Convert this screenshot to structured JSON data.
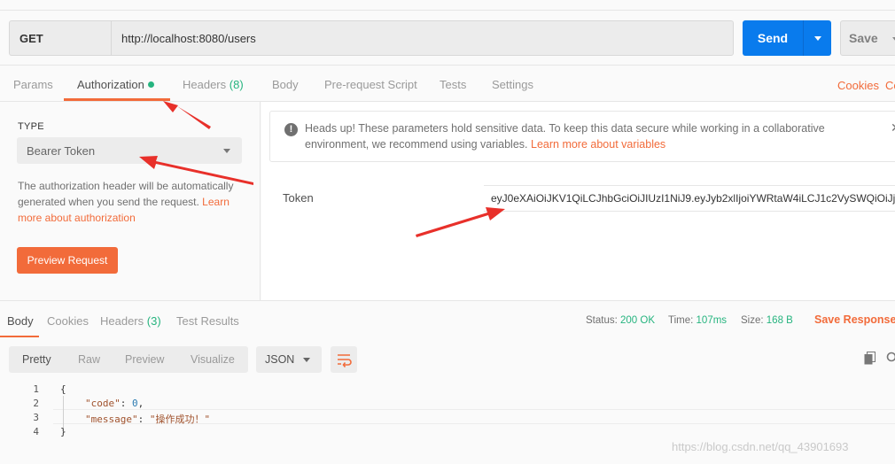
{
  "request": {
    "method": "GET",
    "url": "http://localhost:8080/users",
    "send_label": "Send",
    "save_label": "Save"
  },
  "request_tabs": [
    {
      "label": "Params"
    },
    {
      "label": "Authorization"
    },
    {
      "label": "Headers",
      "count": "(8)"
    },
    {
      "label": "Body"
    },
    {
      "label": "Pre-request Script"
    },
    {
      "label": "Tests"
    },
    {
      "label": "Settings"
    }
  ],
  "cookies_label": "Cookies",
  "code_label": "Co",
  "auth": {
    "type_label": "TYPE",
    "type_value": "Bearer Token",
    "description": "The authorization header will be automatically generated when you send the request.",
    "learn_more": "Learn more about authorization",
    "preview_label": "Preview Request",
    "notice_text": "Heads up! These parameters hold sensitive data. To keep this data secure while working in a collaborative environment, we recommend using variables.",
    "notice_link": "Learn more about variables",
    "token_label": "Token",
    "token_value": "eyJ0eXAiOiJKV1QiLCJhbGciOiJIUzI1NiJ9.eyJyb2xlIjoiYWRtaW4iLCJ1c2VySWQiOiJj..."
  },
  "response_tabs": [
    {
      "label": "Body"
    },
    {
      "label": "Cookies"
    },
    {
      "label": "Headers",
      "count": "(3)"
    },
    {
      "label": "Test Results"
    }
  ],
  "response_meta": {
    "status_label": "Status:",
    "status_value": "200 OK",
    "time_label": "Time:",
    "time_value": "107ms",
    "size_label": "Size:",
    "size_value": "168 B",
    "save_response": "Save Response"
  },
  "view_modes": [
    "Pretty",
    "Raw",
    "Preview",
    "Visualize"
  ],
  "format": "JSON",
  "code_lines": [
    "1",
    "2",
    "3",
    "4"
  ],
  "json": {
    "open": "{",
    "code_key": "\"code\"",
    "code_sep": ": ",
    "code_val": "0",
    "code_tail": ",",
    "msg_key": "\"message\"",
    "msg_sep": ": ",
    "msg_val": "\"操作成功！\"",
    "close": "}"
  },
  "watermark": "https://blog.csdn.net/qq_43901693",
  "colors": {
    "accent": "#f26b3a",
    "send": "#097bed",
    "success": "#26b47f",
    "annotation_arrow": "#e8302a"
  }
}
